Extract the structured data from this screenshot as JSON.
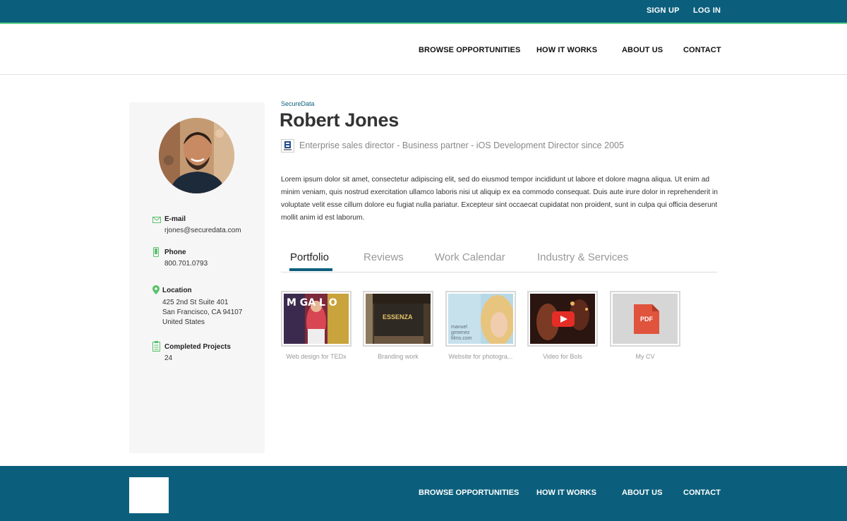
{
  "topbar": {
    "signup": "SIGN UP",
    "login": "LOG IN"
  },
  "nav": {
    "browse": "BROWSE OPPORTUNITIES",
    "how": "HOW IT WORKS",
    "about": "ABOUT US",
    "contact": "CONTACT"
  },
  "profile": {
    "company": "SecureData",
    "name": "Robert Jones",
    "subtitle": "Enterprise sales director - Business partner - iOS Development Director  since 2005",
    "bio": "Lorem ipsum dolor sit amet, consectetur adipiscing elit, sed do eiusmod tempor incididunt ut labore et dolore magna aliqua. Ut enim ad minim veniam, quis nostrud exercitation ullamco laboris nisi ut aliquip ex ea commodo consequat. Duis aute irure dolor in reprehenderit in voluptate velit esse cillum dolore eu fugiat nulla pariatur. Excepteur sint occaecat cupidatat non proident, sunt in culpa qui officia deserunt mollit anim id est laborum."
  },
  "contact": {
    "email_label": "E-mail",
    "email": "rjones@securedata.com",
    "phone_label": "Phone",
    "phone": "800.701.0793",
    "location_label": "Location",
    "address1": "425 2nd St Suite 401",
    "address2": "San Francisco, CA 94107",
    "address3": "United States",
    "projects_label": "Completed Projects",
    "projects": "24"
  },
  "tabs": [
    "Portfolio",
    "Reviews",
    "Work Calendar",
    "Industry & Services"
  ],
  "portfolio": [
    {
      "caption": "Web design for TEDx",
      "thumb_text": "M GA L O"
    },
    {
      "caption": "Branding work",
      "thumb_text": "ESSENZA"
    },
    {
      "caption": "Website for photogra...",
      "thumb_text": "manuel gimenez films.com"
    },
    {
      "caption": "Video for Bols"
    },
    {
      "caption": "My CV",
      "thumb_text": "PDF"
    }
  ],
  "footer": {
    "browse": "BROWSE OPPORTUNITIES",
    "how": "HOW IT WORKS",
    "about": "ABOUT US",
    "contact": "CONTACT"
  },
  "colors": {
    "brand": "#0b5f7c",
    "accent": "#5fd38d",
    "icon_green": "#5cc36e",
    "pdf_red": "#e0533d"
  }
}
